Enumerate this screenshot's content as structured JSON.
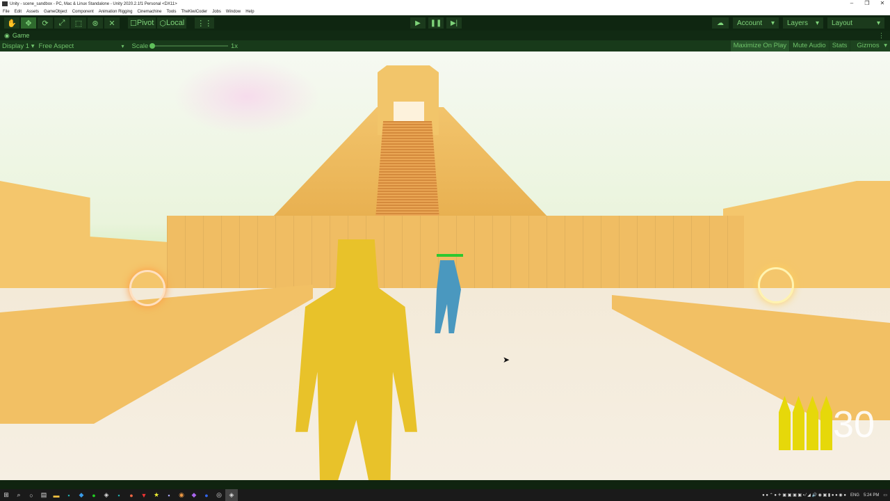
{
  "window": {
    "title": "Unity - scene_sandbox - PC, Mac & Linux Standalone - Unity 2020.2.1f1 Personal <DX11>"
  },
  "menu": [
    "File",
    "Edit",
    "Assets",
    "GameObject",
    "Component",
    "Animation Rigging",
    "Cinemachine",
    "Tools",
    "TheKiwiCoder",
    "Jobs",
    "Window",
    "Help"
  ],
  "toolbar": {
    "pivot": "Pivot",
    "local": "Local",
    "account": "Account",
    "layers": "Layers",
    "layout": "Layout"
  },
  "game_tab": {
    "label": "Game"
  },
  "game_bar": {
    "display": "Display 1",
    "aspect": "Free Aspect",
    "scale_label": "Scale",
    "scale_value": "1x",
    "maximize": "Maximize On Play",
    "mute": "Mute Audio",
    "stats": "Stats",
    "gizmos": "Gizmos"
  },
  "hud": {
    "ammo": "30",
    "ammo_icons": 4
  },
  "tray": {
    "lang": "ENG",
    "time": "5:24 PM"
  }
}
